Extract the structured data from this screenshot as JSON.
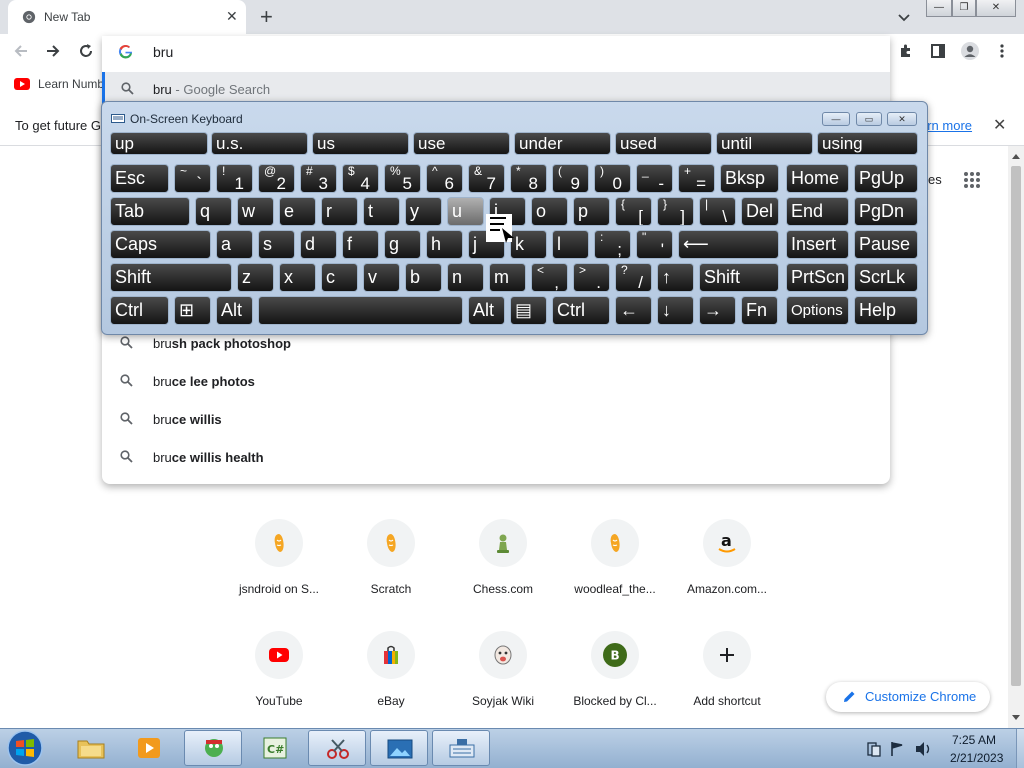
{
  "browser": {
    "tab_title": "New Tab",
    "tab_close": "✕",
    "new_tab": "+",
    "window_buttons": [
      "—",
      "❐",
      "✕"
    ]
  },
  "omnibox": {
    "value": "bru",
    "first_suggestion": {
      "text": "bru",
      "suffix": " - Google Search"
    },
    "suggestions": [
      {
        "typed": "bru",
        "rest": "sh pack photoshop"
      },
      {
        "typed": "bru",
        "rest": "ce lee photos"
      },
      {
        "typed": "bru",
        "rest": "ce willis"
      },
      {
        "typed": "bru",
        "rest": "ce willis health"
      }
    ]
  },
  "bookmarks": [
    {
      "label": "Learn Numb",
      "icon": "youtube-icon"
    }
  ],
  "infobar": {
    "text": "To get future G",
    "link": "arn more",
    "close": "✕"
  },
  "ntp_fragment": "es",
  "osk": {
    "title": "On-Screen Keyboard",
    "predictions": [
      "up",
      "u.s.",
      "us",
      "use",
      "under",
      "used",
      "until",
      "using"
    ],
    "row1": [
      {
        "main": "Esc"
      },
      {
        "shift": "~",
        "low": "`"
      },
      {
        "shift": "!",
        "low": "1"
      },
      {
        "shift": "@",
        "low": "2"
      },
      {
        "shift": "#",
        "low": "3"
      },
      {
        "shift": "$",
        "low": "4"
      },
      {
        "shift": "%",
        "low": "5"
      },
      {
        "shift": "^",
        "low": "6"
      },
      {
        "shift": "&",
        "low": "7"
      },
      {
        "shift": "*",
        "low": "8"
      },
      {
        "shift": "(",
        "low": "9"
      },
      {
        "shift": ")",
        "low": "0"
      },
      {
        "shift": "_",
        "low": "-"
      },
      {
        "shift": "+",
        "low": "="
      },
      {
        "main": "Bksp"
      },
      {
        "main": "Home"
      },
      {
        "main": "PgUp"
      }
    ],
    "row2": [
      {
        "main": "Tab"
      },
      {
        "main": "q"
      },
      {
        "main": "w"
      },
      {
        "main": "e"
      },
      {
        "main": "r"
      },
      {
        "main": "t"
      },
      {
        "main": "y"
      },
      {
        "main": "u"
      },
      {
        "main": "i"
      },
      {
        "main": "o"
      },
      {
        "main": "p"
      },
      {
        "shift": "{",
        "low": "["
      },
      {
        "shift": "}",
        "low": "]"
      },
      {
        "shift": "|",
        "low": "\\"
      },
      {
        "main": "Del"
      },
      {
        "main": "End"
      },
      {
        "main": "PgDn"
      }
    ],
    "row3": [
      {
        "main": "Caps"
      },
      {
        "main": "a"
      },
      {
        "main": "s"
      },
      {
        "main": "d"
      },
      {
        "main": "f"
      },
      {
        "main": "g"
      },
      {
        "main": "h"
      },
      {
        "main": "j"
      },
      {
        "main": "k"
      },
      {
        "main": "l"
      },
      {
        "shift": ":",
        "low": ";"
      },
      {
        "shift": "\"",
        "low": "'"
      },
      {
        "main": "⟵"
      },
      {
        "main": "Insert"
      },
      {
        "main": "Pause"
      }
    ],
    "row4": [
      {
        "main": "Shift"
      },
      {
        "main": "z"
      },
      {
        "main": "x"
      },
      {
        "main": "c"
      },
      {
        "main": "v"
      },
      {
        "main": "b"
      },
      {
        "main": "n"
      },
      {
        "main": "m"
      },
      {
        "shift": "<",
        "low": ","
      },
      {
        "shift": ">",
        "low": "."
      },
      {
        "shift": "?",
        "low": "/"
      },
      {
        "main": "↑"
      },
      {
        "main": "Shift"
      },
      {
        "main": "PrtScn"
      },
      {
        "main": "ScrLk"
      }
    ],
    "row5": [
      {
        "main": "Ctrl"
      },
      {
        "main": "⊞"
      },
      {
        "main": "Alt"
      },
      {
        "main": ""
      },
      {
        "main": "Alt"
      },
      {
        "main": "▤"
      },
      {
        "main": "Ctrl"
      },
      {
        "main": "←"
      },
      {
        "main": "↓"
      },
      {
        "main": "→"
      },
      {
        "main": "Fn"
      },
      {
        "main": "Options"
      },
      {
        "main": "Help"
      }
    ],
    "pressed_key": "u"
  },
  "shortcuts": [
    {
      "label": "jsndroid on S...",
      "icon": "scratch-cat-icon"
    },
    {
      "label": "Scratch",
      "icon": "scratch-cat-icon"
    },
    {
      "label": "Chess.com",
      "icon": "chess-pawn-icon"
    },
    {
      "label": "woodleaf_the...",
      "icon": "scratch-cat-icon"
    },
    {
      "label": "Amazon.com...",
      "icon": "amazon-icon"
    },
    {
      "label": "YouTube",
      "icon": "youtube-icon"
    },
    {
      "label": "eBay",
      "icon": "ebay-bag-icon"
    },
    {
      "label": "Soyjak Wiki",
      "icon": "soyjak-icon"
    },
    {
      "label": "Blocked by Cl...",
      "icon": "letter-b-icon",
      "letter": "B"
    },
    {
      "label": "Add shortcut",
      "icon": "plus-icon"
    }
  ],
  "customize_label": "Customize Chrome",
  "taskbar": {
    "time": "7:25 AM",
    "date": "2/21/2023",
    "items": [
      "start",
      "file-explorer",
      "media-player",
      "app-avatar",
      "csharp-editor",
      "paint",
      "photo-viewer",
      "on-screen-keyboard"
    ]
  },
  "colors": {
    "accent": "#1a73e8",
    "osk_frame": "#b4c8e0",
    "key": "#1e1e1e",
    "taskbar": "#a7c0dc"
  }
}
